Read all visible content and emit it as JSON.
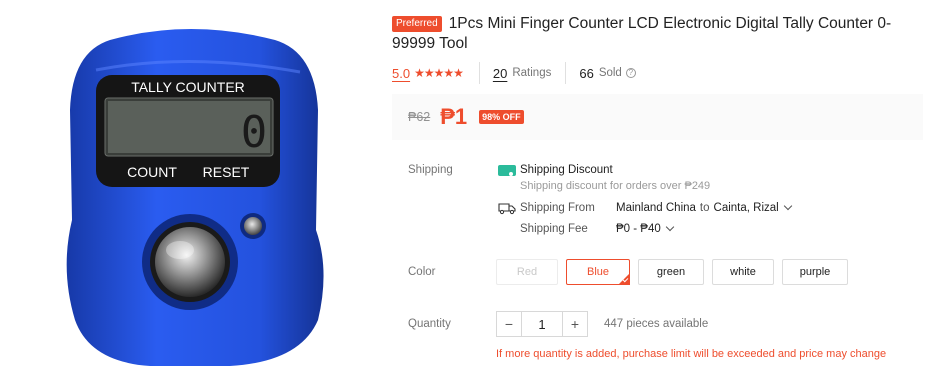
{
  "product_image": {
    "device_top_label": "TALLY COUNTER",
    "device_count_label": "COUNT",
    "device_reset_label": "RESET",
    "device_display_digit": "0",
    "body_color": "#1f4fd8"
  },
  "product": {
    "badge": "Preferred",
    "title": "1Pcs Mini Finger Counter LCD Electronic Digital Tally Counter 0-99999 Tool",
    "rating_score": "5.0",
    "stars": "★★★★★",
    "ratings_count": "20",
    "ratings_label": "Ratings",
    "sold_count": "66",
    "sold_label": "Sold",
    "help_icon": "?"
  },
  "price": {
    "original": "₱62",
    "current": "₱1",
    "discount": "98% OFF"
  },
  "shipping": {
    "label": "Shipping",
    "discount_title": "Shipping Discount",
    "discount_sub": "Shipping discount for orders over ₱249",
    "from_label": "Shipping From",
    "from_value": "Mainland China",
    "to_word": "to",
    "to_value": "Cainta, Rizal",
    "fee_label": "Shipping Fee",
    "fee_value": "₱0 - ₱40"
  },
  "color": {
    "label": "Color",
    "options": [
      "Red",
      "Blue",
      "green",
      "white",
      "purple"
    ],
    "selected": "Blue"
  },
  "quantity": {
    "label": "Quantity",
    "minus": "−",
    "plus": "+",
    "value": "1",
    "available": "447 pieces available",
    "warning": "If more quantity is added, purchase limit will be exceeded and price may change"
  },
  "colors": {
    "accent": "#ee4d2d",
    "free_ship": "#2bbb9b"
  }
}
